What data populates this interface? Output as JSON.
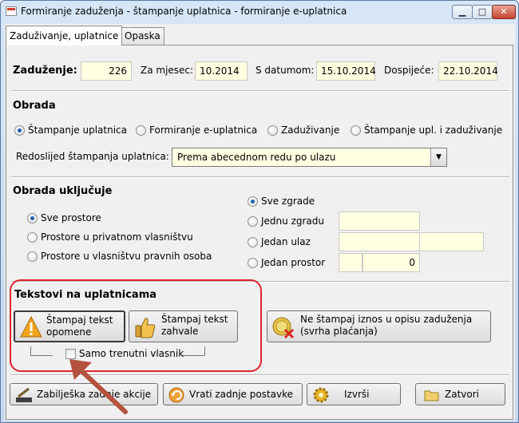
{
  "window": {
    "title": "Formiranje zaduženja - štampanje uplatnica - formiranje e-uplatnica"
  },
  "tabs": [
    "Zaduživanje, uplatnice",
    "Opaska"
  ],
  "header": {
    "zaduzenje_label": "Zaduženje:",
    "zaduzenje_value": "226",
    "za_mjesec_label": "Za mjesec:",
    "za_mjesec_value": "10.2014",
    "s_datumom_label": "S datumom:",
    "s_datumom_value": "15.10.2014",
    "dospijece_label": "Dospijeće:",
    "dospijece_value": "22.10.2014"
  },
  "obrada": {
    "title": "Obrada",
    "options": [
      "Štampanje uplatnica",
      "Formiranje e-uplatnica",
      "Zaduživanje",
      "Štampanje upl. i zaduživanje"
    ],
    "selected_index": 0,
    "redoslijed_label": "Redoslijed štampanja uplatnica:",
    "redoslijed_value": "Prema abecednom redu po ulazu"
  },
  "obrada_ukljucuje": {
    "title": "Obrada uključuje",
    "left_options": [
      "Sve prostore",
      "Prostore u privatnom vlasništvu",
      "Prostore u vlasništvu pravnih osoba"
    ],
    "left_selected_index": 0,
    "right_options": [
      "Sve zgrade",
      "Jednu zgradu",
      "Jedan ulaz",
      "Jedan prostor"
    ],
    "right_selected_index": 0,
    "jedan_prostor_value": "0"
  },
  "tekstovi": {
    "title": "Tekstovi na uplatnicama",
    "btn_opomene_line1": "Štampaj tekst",
    "btn_opomene_line2": "opomene",
    "btn_zahvale_line1": "Štampaj tekst",
    "btn_zahvale_line2": "zahvale",
    "btn_iznos_line1": "Ne štampaj iznos u opisu zaduženja",
    "btn_iznos_line2": "(svrha plaćanja)",
    "samo_trenutni_label": "Samo trenutni vlasnik",
    "samo_trenutni_checked": false
  },
  "footer": {
    "zabiljeska": "Zabilješka zadnje akcije",
    "vrati": "Vrati zadnje postavke",
    "izvrsi": "Izvrši",
    "zatvori": "Zatvori"
  },
  "colors": {
    "highlight": "#e0242f",
    "field_bg": "#ffffe1",
    "arrow": "#b4523f"
  }
}
